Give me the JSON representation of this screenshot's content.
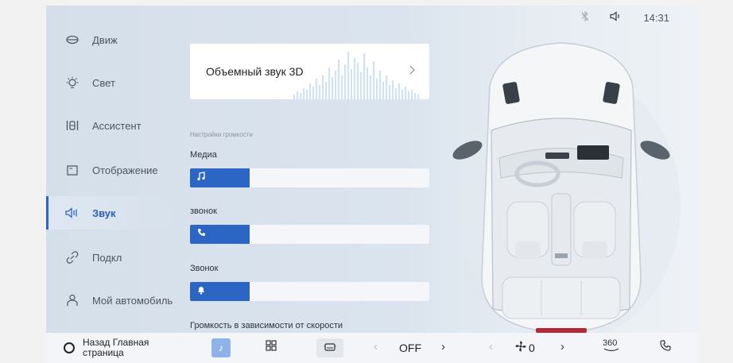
{
  "status": {
    "time": "14:31"
  },
  "sidebar": {
    "items": [
      {
        "label": "Движ",
        "icon": "steering-icon"
      },
      {
        "label": "Свет",
        "icon": "light-bulb-icon"
      },
      {
        "label": "Ассистент",
        "icon": "assistant-icon"
      },
      {
        "label": "Отображение",
        "icon": "display-icon"
      },
      {
        "label": "Звук",
        "icon": "speaker-icon",
        "active": true
      },
      {
        "label": "Подкл",
        "icon": "link-icon"
      },
      {
        "label": "Мой автомобиль",
        "icon": "person-icon"
      }
    ]
  },
  "main": {
    "surround_label": "Объемный звук 3D",
    "section_title": "Настройки громкости",
    "volumes": [
      {
        "label": "Медиа",
        "icon": "music-note-icon",
        "level": 0.25
      },
      {
        "label": "звонок",
        "icon": "phone-icon",
        "level": 0.25
      },
      {
        "label": "Звонок",
        "icon": "bell-icon",
        "level": 0.25
      }
    ],
    "speed_label": "Громкость в зависимости от скорости"
  },
  "dock": {
    "home_label": "Назад Главная страница",
    "fan_mode": "OFF",
    "fan_speed": "0",
    "view_360": "360",
    "accent_color": "#2c66c4"
  }
}
